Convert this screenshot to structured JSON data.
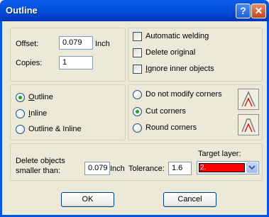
{
  "window": {
    "title": "Outline",
    "help": "?",
    "close": "✕"
  },
  "offset": {
    "label": "Offset:",
    "value": "0.079",
    "unit": "Inch"
  },
  "copies": {
    "label": "Copies:",
    "value": "1"
  },
  "options": {
    "automatic_welding": {
      "label": "Automatic welding",
      "checked": false
    },
    "delete_original": {
      "label": "Delete original",
      "checked": false
    },
    "ignore_inner": {
      "label_accel": "I",
      "label_rest": "gnore inner objects",
      "checked": false
    }
  },
  "mode": {
    "outline": {
      "accel": "O",
      "rest": "utline",
      "selected": true
    },
    "inline": {
      "accel": "I",
      "rest": "nline",
      "selected": false
    },
    "both": {
      "label": "Outline & Inline",
      "selected": false
    }
  },
  "corners": {
    "no_modify": {
      "label": "Do not modify corners",
      "selected": false
    },
    "cut": {
      "label": "Cut corners",
      "selected": true
    },
    "round": {
      "label": "Round corners",
      "selected": false
    }
  },
  "bottom": {
    "delete_label_1": "Delete objects",
    "delete_label_2": "smaller than:",
    "delete_value": "0.079",
    "delete_unit": "Inch",
    "tolerance_label": "Tolerance:",
    "tolerance_value": "1.6",
    "target_label": "Target layer:",
    "target_value": "2.",
    "target_color": "#ff0000"
  },
  "buttons": {
    "ok": "OK",
    "cancel": "Cancel"
  }
}
